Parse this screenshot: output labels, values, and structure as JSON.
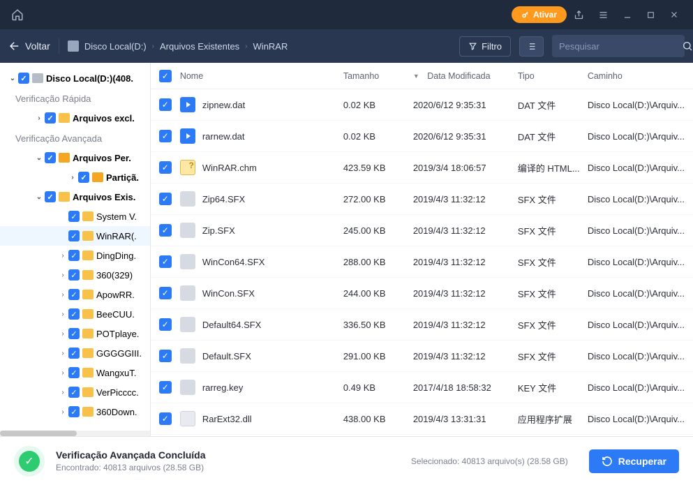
{
  "titlebar": {
    "activate": "Ativar"
  },
  "toolbar": {
    "back": "Voltar",
    "filter": "Filtro",
    "search_placeholder": "Pesquisar"
  },
  "breadcrumb": [
    "Disco Local(D:)",
    "Arquivos Existentes",
    "WinRAR"
  ],
  "sidebar": {
    "root": "Disco Local(D:)(408.",
    "quick_scan": "Verificação Rápida",
    "quick_items": [
      "Arquivos excl."
    ],
    "advanced_scan": "Verificação Avançada",
    "adv1": "Arquivos Per.",
    "adv1_children": [
      "Partiçã."
    ],
    "adv2": "Arquivos Exis.",
    "adv2_children": [
      "System V.",
      "WinRAR(.",
      "DingDing.",
      "360(329)",
      "ApowRR.",
      "BeeCUU.",
      "POTplaye.",
      "GGGGGIII.",
      "WangxuT.",
      "VerPicccc.",
      "360Down."
    ]
  },
  "columns": {
    "name": "Nome",
    "size": "Tamanho",
    "date": "Data Modificada",
    "type": "Tipo",
    "path": "Caminho"
  },
  "files": [
    {
      "name": "zipnew.dat",
      "size": "0.02 KB",
      "date": "2020/6/12 9:35:31",
      "type": "DAT 文件",
      "path": "Disco Local(D:)\\Arquiv...",
      "icon": "blue"
    },
    {
      "name": "rarnew.dat",
      "size": "0.02 KB",
      "date": "2020/6/12 9:35:31",
      "type": "DAT 文件",
      "path": "Disco Local(D:)\\Arquiv...",
      "icon": "blue"
    },
    {
      "name": "WinRAR.chm",
      "size": "423.59 KB",
      "date": "2019/3/4 18:06:57",
      "type": "编译的 HTML...",
      "path": "Disco Local(D:)\\Arquiv...",
      "icon": "help"
    },
    {
      "name": "Zip64.SFX",
      "size": "272.00 KB",
      "date": "2019/4/3 11:32:12",
      "type": "SFX 文件",
      "path": "Disco Local(D:)\\Arquiv...",
      "icon": "file"
    },
    {
      "name": "Zip.SFX",
      "size": "245.00 KB",
      "date": "2019/4/3 11:32:12",
      "type": "SFX 文件",
      "path": "Disco Local(D:)\\Arquiv...",
      "icon": "file"
    },
    {
      "name": "WinCon64.SFX",
      "size": "288.00 KB",
      "date": "2019/4/3 11:32:12",
      "type": "SFX 文件",
      "path": "Disco Local(D:)\\Arquiv...",
      "icon": "file"
    },
    {
      "name": "WinCon.SFX",
      "size": "244.00 KB",
      "date": "2019/4/3 11:32:12",
      "type": "SFX 文件",
      "path": "Disco Local(D:)\\Arquiv...",
      "icon": "file"
    },
    {
      "name": "Default64.SFX",
      "size": "336.50 KB",
      "date": "2019/4/3 11:32:12",
      "type": "SFX 文件",
      "path": "Disco Local(D:)\\Arquiv...",
      "icon": "file"
    },
    {
      "name": "Default.SFX",
      "size": "291.00 KB",
      "date": "2019/4/3 11:32:12",
      "type": "SFX 文件",
      "path": "Disco Local(D:)\\Arquiv...",
      "icon": "file"
    },
    {
      "name": "rarreg.key",
      "size": "0.49 KB",
      "date": "2017/4/18 18:58:32",
      "type": "KEY 文件",
      "path": "Disco Local(D:)\\Arquiv...",
      "icon": "file"
    },
    {
      "name": "RarExt32.dll",
      "size": "438.00 KB",
      "date": "2019/4/3 13:31:31",
      "type": "应用程序扩展",
      "path": "Disco Local(D:)\\Arquiv...",
      "icon": "dll"
    }
  ],
  "footer": {
    "heading": "Verificação Avançada Concluída",
    "found": "Encontrado: 40813 arquivos (28.58 GB)",
    "selected": "Selecionado: 40813 arquivo(s) (28.58 GB)",
    "recover": "Recuperar"
  }
}
